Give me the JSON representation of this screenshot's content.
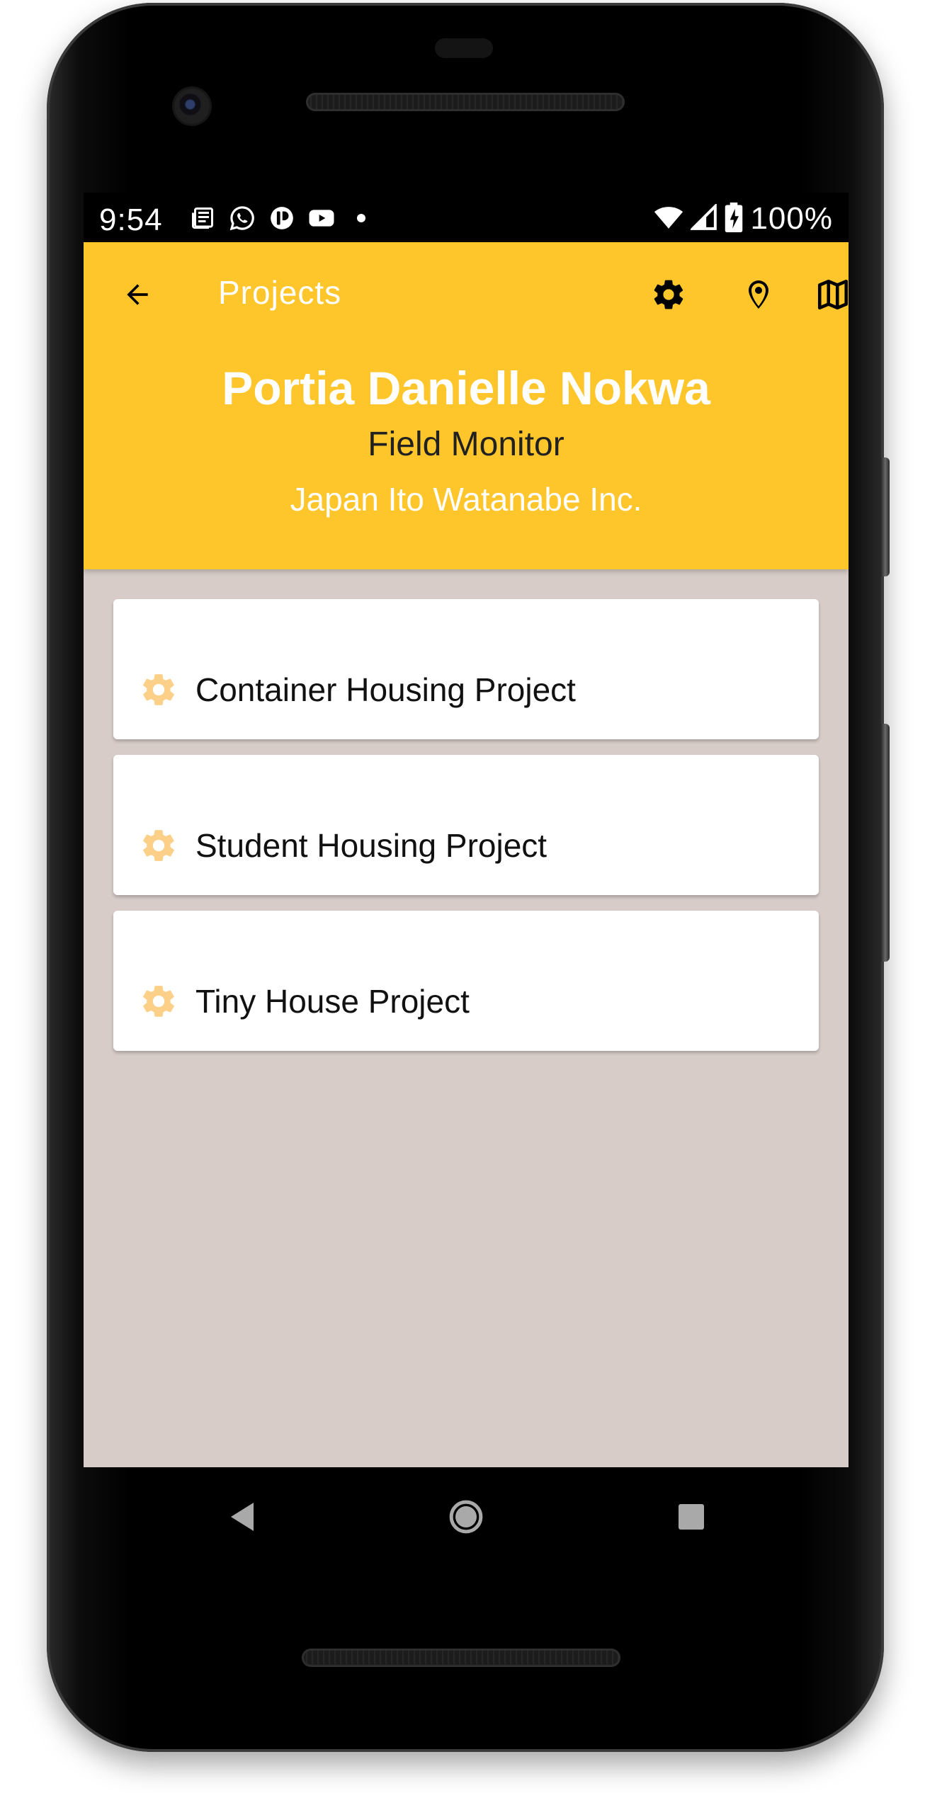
{
  "status_bar": {
    "time": "9:54",
    "battery_percent": "100%",
    "notification_icons": [
      "news-icon",
      "whatsapp-icon",
      "app-icon",
      "youtube-icon",
      "dot-icon"
    ],
    "status_icons": [
      "wifi-icon",
      "signal-icon",
      "battery-charging-icon"
    ]
  },
  "toolbar": {
    "title": "Projects",
    "back_icon": "arrow-back-icon",
    "actions": [
      "settings-icon",
      "location-pin-icon",
      "map-icon"
    ]
  },
  "profile": {
    "name": "Portia Danielle Nokwa",
    "role": "Field Monitor",
    "organization": "Japan Ito Watanabe Inc."
  },
  "projects": [
    {
      "name": "Container Housing Project",
      "icon": "gear-icon"
    },
    {
      "name": "Student Housing Project",
      "icon": "gear-icon"
    },
    {
      "name": "Tiny House Project",
      "icon": "gear-icon"
    }
  ],
  "nav_bar": {
    "buttons": [
      "nav-back-icon",
      "nav-home-icon",
      "nav-recents-icon"
    ]
  },
  "colors": {
    "header": "#fec62b",
    "background": "#d7ccc8",
    "card": "#ffffff",
    "project_icon": "#fdd089"
  }
}
